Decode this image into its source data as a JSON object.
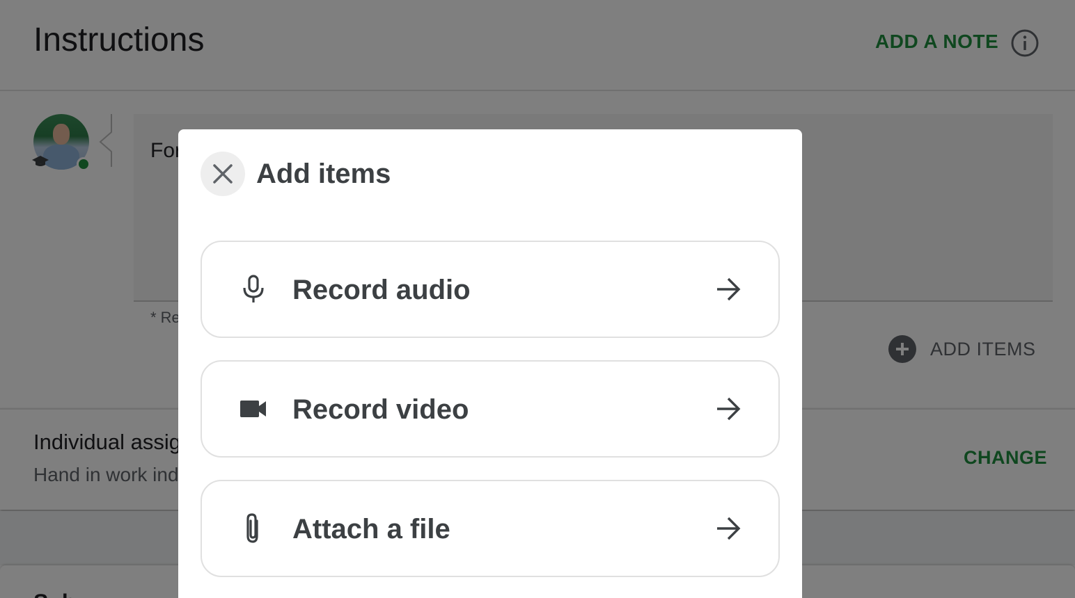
{
  "header": {
    "title": "Instructions",
    "add_note_label": "ADD A NOTE"
  },
  "note": {
    "text_visible": "For",
    "required_hint": "* Re",
    "add_items_label": "ADD ITEMS"
  },
  "assignment": {
    "title": "Individual assig",
    "subtitle": "Hand in work ind",
    "change_label": "CHANGE"
  },
  "next_section": {
    "title": "Sub"
  },
  "dialog": {
    "title": "Add items",
    "options": [
      {
        "label": "Record audio",
        "icon": "microphone-icon"
      },
      {
        "label": "Record video",
        "icon": "video-camera-icon"
      },
      {
        "label": "Attach a file",
        "icon": "paperclip-icon"
      }
    ]
  },
  "colors": {
    "accent_green": "#1e8e3e",
    "scrim": "rgba(0,0,0,0.5)"
  }
}
